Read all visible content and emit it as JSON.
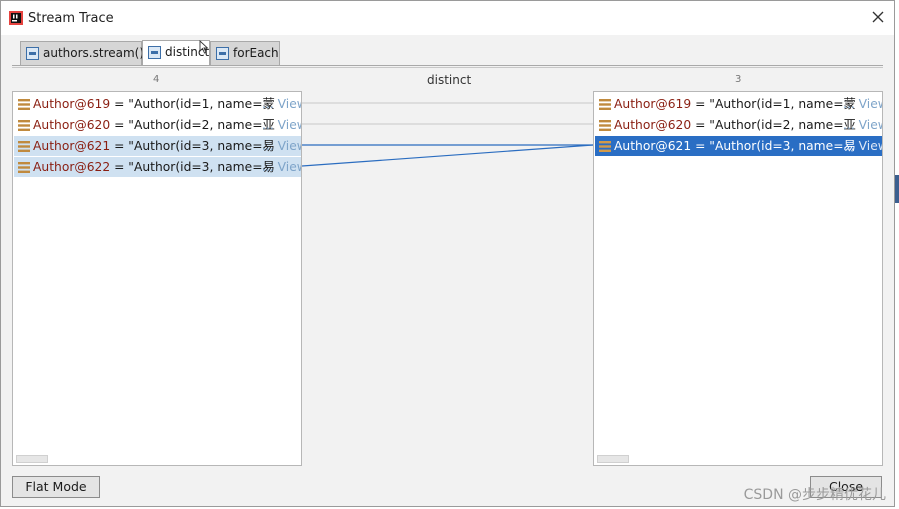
{
  "window": {
    "title": "Stream Trace"
  },
  "tabs": [
    {
      "label": "authors.stream()",
      "active": false
    },
    {
      "label": "distinct",
      "active": true
    },
    {
      "label": "forEach",
      "active": false
    }
  ],
  "columns": {
    "left_count": "4",
    "center_label": "distinct",
    "right_count": "3"
  },
  "left_rows": [
    {
      "name": "Author@619",
      "eq": " = ",
      "value": "\"Author(id=1, name=蒙",
      "view": "... View",
      "state": "normal"
    },
    {
      "name": "Author@620",
      "eq": " = ",
      "value": "\"Author(id=2, name=亚",
      "view": "... View",
      "state": "normal"
    },
    {
      "name": "Author@621",
      "eq": " = ",
      "value": "\"Author(id=3, name=易",
      "view": "... View",
      "state": "light"
    },
    {
      "name": "Author@622",
      "eq": " = ",
      "value": "\"Author(id=3, name=易",
      "view": "... View",
      "state": "light"
    }
  ],
  "right_rows": [
    {
      "name": "Author@619",
      "eq": " = ",
      "value": "\"Author(id=1, name=蒙",
      "view": "... View",
      "state": "normal"
    },
    {
      "name": "Author@620",
      "eq": " = ",
      "value": "\"Author(id=2, name=亚",
      "view": "... View",
      "state": "normal"
    },
    {
      "name": "Author@621",
      "eq": " = ",
      "value": "\"Author(id=3, name=易",
      "view": "... View",
      "state": "strong"
    }
  ],
  "buttons": {
    "flat_mode": "Flat Mode",
    "close": "Close"
  },
  "watermark": "CSDN @步步精优花儿",
  "colors": {
    "selection_strong": "#2a6ec4",
    "selection_light": "#cfe1f1",
    "link_line": "#2b6dc0",
    "name_text": "#8a1f12",
    "view_text": "#7ea4c9"
  }
}
